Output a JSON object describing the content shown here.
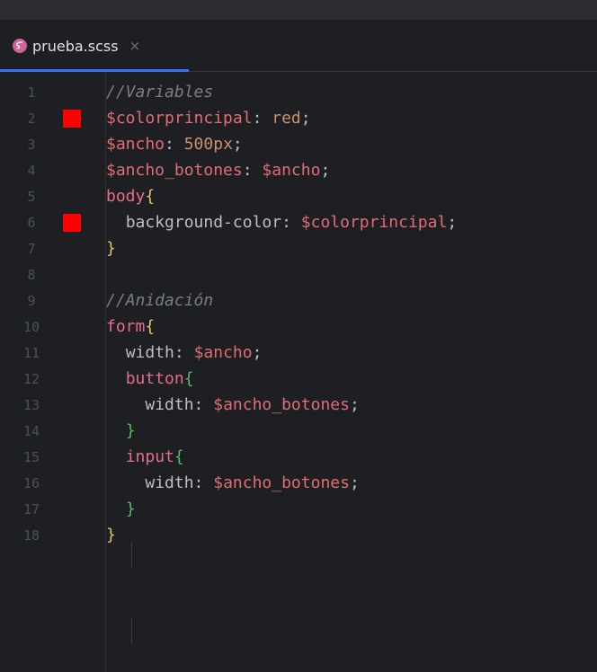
{
  "tab": {
    "filename": "prueba.scss",
    "close": "×"
  },
  "colors": {
    "swatch": "#ff0000",
    "accent": "#3574f0"
  },
  "lines": [
    {
      "n": "1",
      "swatch": false,
      "indent": "",
      "tokens": [
        {
          "t": "//Variables",
          "c": "t-comment"
        }
      ]
    },
    {
      "n": "2",
      "swatch": true,
      "indent": "",
      "tokens": [
        {
          "t": "$colorprincipal",
          "c": "t-var2"
        },
        {
          "t": ": ",
          "c": "t-punct"
        },
        {
          "t": "red",
          "c": "t-kw"
        },
        {
          "t": ";",
          "c": "t-punct"
        }
      ]
    },
    {
      "n": "3",
      "swatch": false,
      "indent": "",
      "tokens": [
        {
          "t": "$ancho",
          "c": "t-var2"
        },
        {
          "t": ": ",
          "c": "t-punct"
        },
        {
          "t": "500px",
          "c": "t-kw"
        },
        {
          "t": ";",
          "c": "t-punct"
        }
      ]
    },
    {
      "n": "4",
      "swatch": false,
      "indent": "",
      "tokens": [
        {
          "t": "$ancho_botones",
          "c": "t-var2"
        },
        {
          "t": ": ",
          "c": "t-punct"
        },
        {
          "t": "$ancho",
          "c": "t-var2"
        },
        {
          "t": ";",
          "c": "t-punct"
        }
      ]
    },
    {
      "n": "5",
      "swatch": false,
      "indent": "",
      "tokens": [
        {
          "t": "body",
          "c": "t-sel"
        },
        {
          "t": "{",
          "c": "b1"
        }
      ]
    },
    {
      "n": "6",
      "swatch": true,
      "indent": "  ",
      "tokens": [
        {
          "t": "background-color",
          "c": "t-prop"
        },
        {
          "t": ": ",
          "c": "t-punct"
        },
        {
          "t": "$colorprincipal",
          "c": "t-var2"
        },
        {
          "t": ";",
          "c": "t-punct"
        }
      ]
    },
    {
      "n": "7",
      "swatch": false,
      "indent": "",
      "tokens": [
        {
          "t": "}",
          "c": "b1"
        }
      ]
    },
    {
      "n": "8",
      "swatch": false,
      "indent": "",
      "tokens": []
    },
    {
      "n": "9",
      "swatch": false,
      "indent": "",
      "tokens": [
        {
          "t": "//Anidación",
          "c": "t-comment"
        }
      ]
    },
    {
      "n": "10",
      "swatch": false,
      "indent": "",
      "tokens": [
        {
          "t": "form",
          "c": "t-sel"
        },
        {
          "t": "{",
          "c": "b1"
        }
      ]
    },
    {
      "n": "11",
      "swatch": false,
      "indent": "  ",
      "tokens": [
        {
          "t": "width",
          "c": "t-prop"
        },
        {
          "t": ": ",
          "c": "t-punct"
        },
        {
          "t": "$ancho",
          "c": "t-var2"
        },
        {
          "t": ";",
          "c": "t-punct"
        }
      ]
    },
    {
      "n": "12",
      "swatch": false,
      "indent": "  ",
      "tokens": [
        {
          "t": "button",
          "c": "t-sel"
        },
        {
          "t": "{",
          "c": "b2"
        }
      ]
    },
    {
      "n": "13",
      "swatch": false,
      "indent": "    ",
      "tokens": [
        {
          "t": "width",
          "c": "t-prop"
        },
        {
          "t": ": ",
          "c": "t-punct"
        },
        {
          "t": "$ancho_botones",
          "c": "t-var2"
        },
        {
          "t": ";",
          "c": "t-punct"
        }
      ]
    },
    {
      "n": "14",
      "swatch": false,
      "indent": "  ",
      "tokens": [
        {
          "t": "}",
          "c": "b2"
        }
      ]
    },
    {
      "n": "15",
      "swatch": false,
      "indent": "  ",
      "tokens": [
        {
          "t": "input",
          "c": "t-sel"
        },
        {
          "t": "{",
          "c": "b2"
        }
      ]
    },
    {
      "n": "16",
      "swatch": false,
      "indent": "    ",
      "tokens": [
        {
          "t": "width",
          "c": "t-prop"
        },
        {
          "t": ": ",
          "c": "t-punct"
        },
        {
          "t": "$ancho_botones",
          "c": "t-var2"
        },
        {
          "t": ";",
          "c": "t-punct"
        }
      ]
    },
    {
      "n": "17",
      "swatch": false,
      "indent": "  ",
      "tokens": [
        {
          "t": "}",
          "c": "b2"
        }
      ]
    },
    {
      "n": "18",
      "swatch": false,
      "indent": "",
      "tokens": [
        {
          "t": "}",
          "c": "b1"
        }
      ]
    }
  ]
}
